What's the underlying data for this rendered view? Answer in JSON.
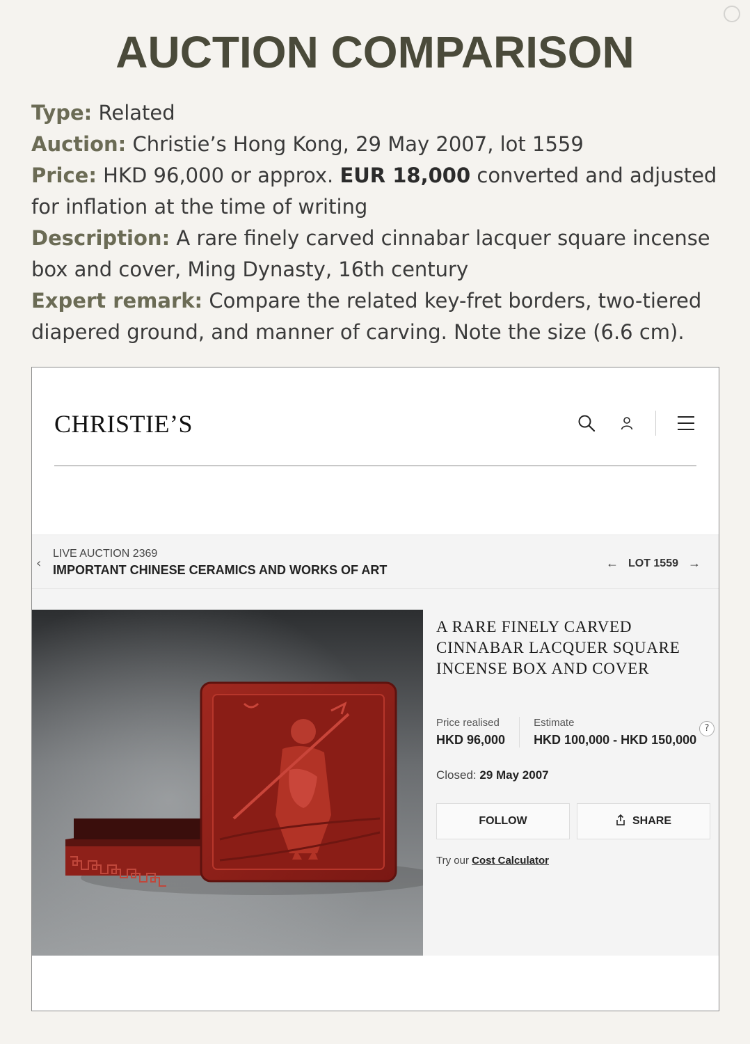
{
  "heading": "AUCTION COMPARISON",
  "details": {
    "type_label": "Type:",
    "type_value": "Related",
    "auction_label": "Auction:",
    "auction_value": "Christie’s Hong Kong, 29 May 2007, lot 1559",
    "price_label": "Price:",
    "price_value_pre": "HKD 96,000 or approx.",
    "price_value_eur": "EUR 18,000",
    "price_value_post": "converted and adjusted for inflation at the time of writing",
    "description_label": "Description:",
    "description_value": "A rare finely carved cinnabar lacquer square incense box and cover, Ming Dynasty, 16th century",
    "remark_label": "Expert remark:",
    "remark_value": "Compare the related key-fret borders, two-tiered diapered ground, and manner of carving. Note the size (6.6 cm)."
  },
  "site": {
    "logo": "CHRISTIE’S",
    "icons": [
      "search-icon",
      "account-icon",
      "menu-icon"
    ]
  },
  "subnav": {
    "sale_number": "LIVE AUCTION 2369",
    "sale_title": "IMPORTANT CHINESE CERAMICS AND WORKS OF ART",
    "lot_label": "LOT 1559"
  },
  "lot": {
    "title": "A RARE FINELY CARVED CINNABAR LACQUER SQUARE INCENSE BOX AND COVER",
    "price_realised_label": "Price realised",
    "price_realised_value": "HKD 96,000",
    "estimate_label": "Estimate",
    "estimate_value": "HKD 100,000 - HKD 150,000",
    "help_glyph": "?",
    "closed_label": "Closed:",
    "closed_value": "29 May 2007",
    "follow_label": "FOLLOW",
    "share_label": "SHARE",
    "calc_prefix": "Try our",
    "calc_link": "Cost Calculator"
  },
  "colors": {
    "page_bg": "#f5f3ef",
    "heading": "#4a4a3a",
    "label": "#6b6b55",
    "lacquer_red": "#a8231e"
  }
}
